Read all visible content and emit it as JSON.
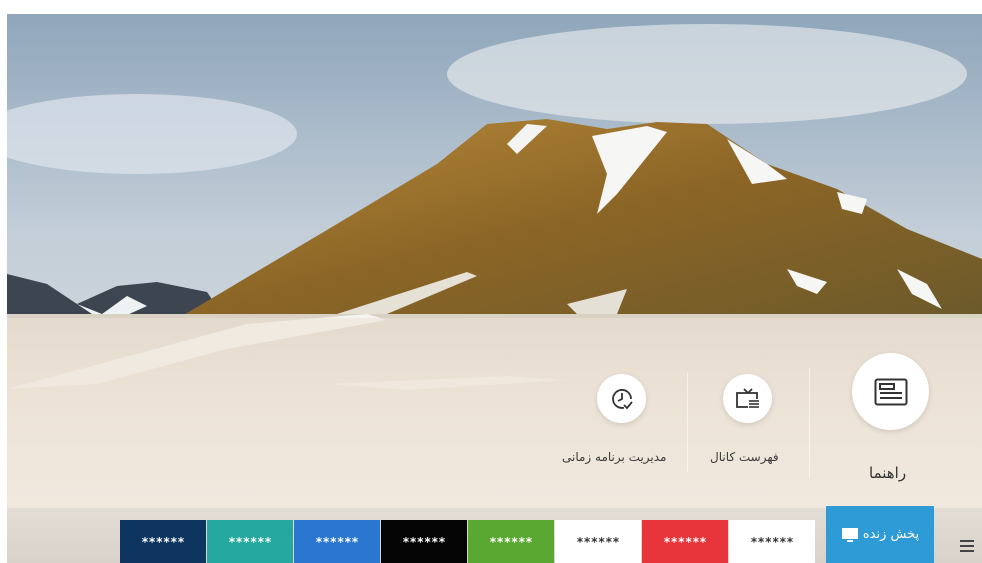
{
  "main_menu": {
    "guide_label": "راهنما",
    "channel_list_label": "فهرست کانال",
    "schedule_manager_label": "مدیریت برنامه زمانی"
  },
  "bottom_bar": {
    "live_tv_label": "پخش زنده",
    "tiles": [
      {
        "label": "******",
        "bg": "#ffffff",
        "fg": "#333333"
      },
      {
        "label": "******",
        "bg": "#e8343b",
        "fg": "#ffffff"
      },
      {
        "label": "******",
        "bg": "#ffffff",
        "fg": "#333333"
      },
      {
        "label": "******",
        "bg": "#5aa832",
        "fg": "#ffffff"
      },
      {
        "label": "******",
        "bg": "#050505",
        "fg": "#ffffff"
      },
      {
        "label": "******",
        "bg": "#2b76cf",
        "fg": "#ffffff"
      },
      {
        "label": "******",
        "bg": "#25a89e",
        "fg": "#ffffff"
      },
      {
        "label": "******",
        "bg": "#0e3560",
        "fg": "#ffffff"
      }
    ]
  },
  "colors": {
    "accent": "#2e9bd6"
  },
  "icons": {
    "guide": "guide-icon",
    "channel_list": "tv-list-icon",
    "schedule": "clock-icon",
    "live": "tv-icon",
    "menu": "hamburger-icon"
  }
}
